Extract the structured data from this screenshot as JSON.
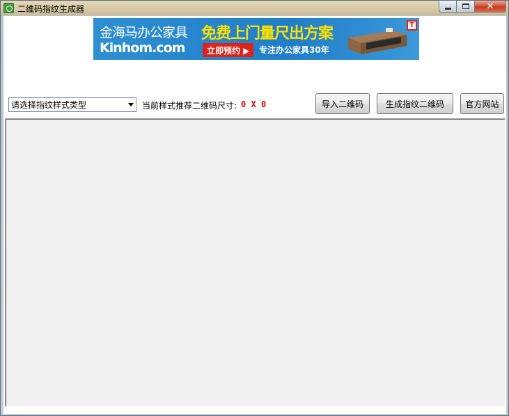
{
  "window": {
    "title": "二维码指纹生成器",
    "close_glyph": "✕"
  },
  "banner": {
    "brand": "金海马办公家具",
    "domain": "Kinhom.com",
    "headline": "免费上门量尺出方案",
    "cta": "立即预约 ▶",
    "tagline": "专注办公家具30年",
    "logo_letter": "T",
    "colors": {
      "background": "#1f7ec9",
      "headline": "#ffe100",
      "cta": "#e0231a"
    }
  },
  "toolbar": {
    "style_select_value": "请选择指纹样式类型",
    "size_label": "当前样式推荐二维码尺寸:",
    "size_value": "0 X 0",
    "import_label": "导入二维码",
    "generate_label": "生成指纹二维码",
    "website_label": "官方网站"
  },
  "colors": {
    "size_value": "#e00000",
    "panel_bg": "#f0f0f0"
  }
}
